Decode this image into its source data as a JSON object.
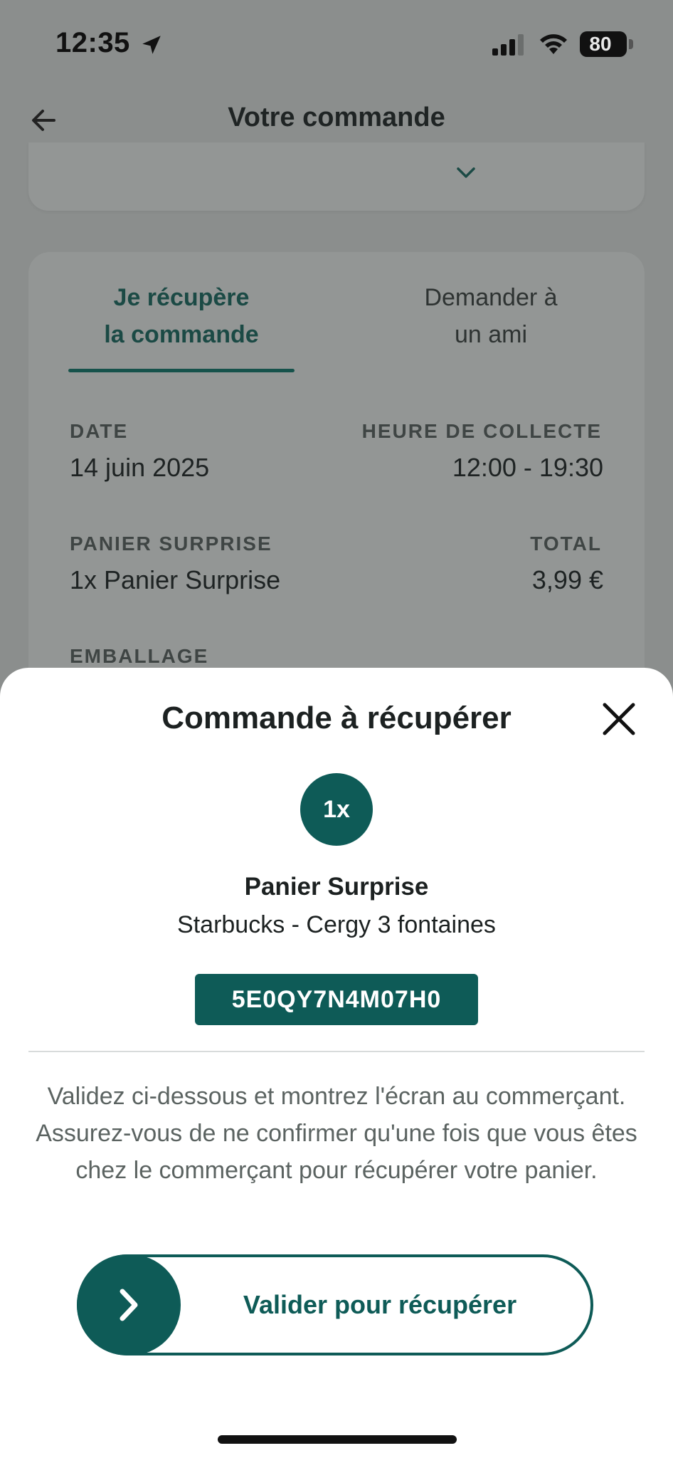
{
  "status_bar": {
    "time": "12:35",
    "battery": "80"
  },
  "nav": {
    "title": "Votre commande"
  },
  "tabs": [
    {
      "label": "Je récupère la commande",
      "line1": "Je récupère",
      "line2": "la commande",
      "active": true
    },
    {
      "label": "Demander à un ami",
      "line1": "Demander à",
      "line2": "un ami",
      "active": false
    }
  ],
  "details": {
    "date_label": "DATE",
    "date_value": "14 juin 2025",
    "pickup_label": "HEURE DE COLLECTE",
    "pickup_value": "12:00 - 19:30",
    "basket_label": "PANIER SURPRISE",
    "basket_value": "1x Panier Surprise",
    "total_label": "TOTAL",
    "total_value": "3,99 €",
    "packaging_label": "EMBALLAGE"
  },
  "sheet": {
    "title": "Commande à récupérer",
    "quantity": "1x",
    "product": "Panier Surprise",
    "store": "Starbucks - Cergy 3 fontaines",
    "code": "5E0QY7N4M07H0",
    "instructions": "Validez ci-dessous et montrez l'écran au commerçant. Assurez-vous de ne confirmer qu'une fois que vous êtes chez le commerçant pour récupérer votre panier.",
    "slide_label": "Valider pour récupérer"
  },
  "colors": {
    "brand": "#0e5b57",
    "overlay_background": "#8b8e8d",
    "sheet_background": "#ffffff"
  },
  "icons": [
    "location-arrow-icon",
    "signal-icon",
    "wifi-icon",
    "battery-icon",
    "back-arrow-icon",
    "chevron-down-icon",
    "close-icon",
    "chevron-right-icon"
  ]
}
